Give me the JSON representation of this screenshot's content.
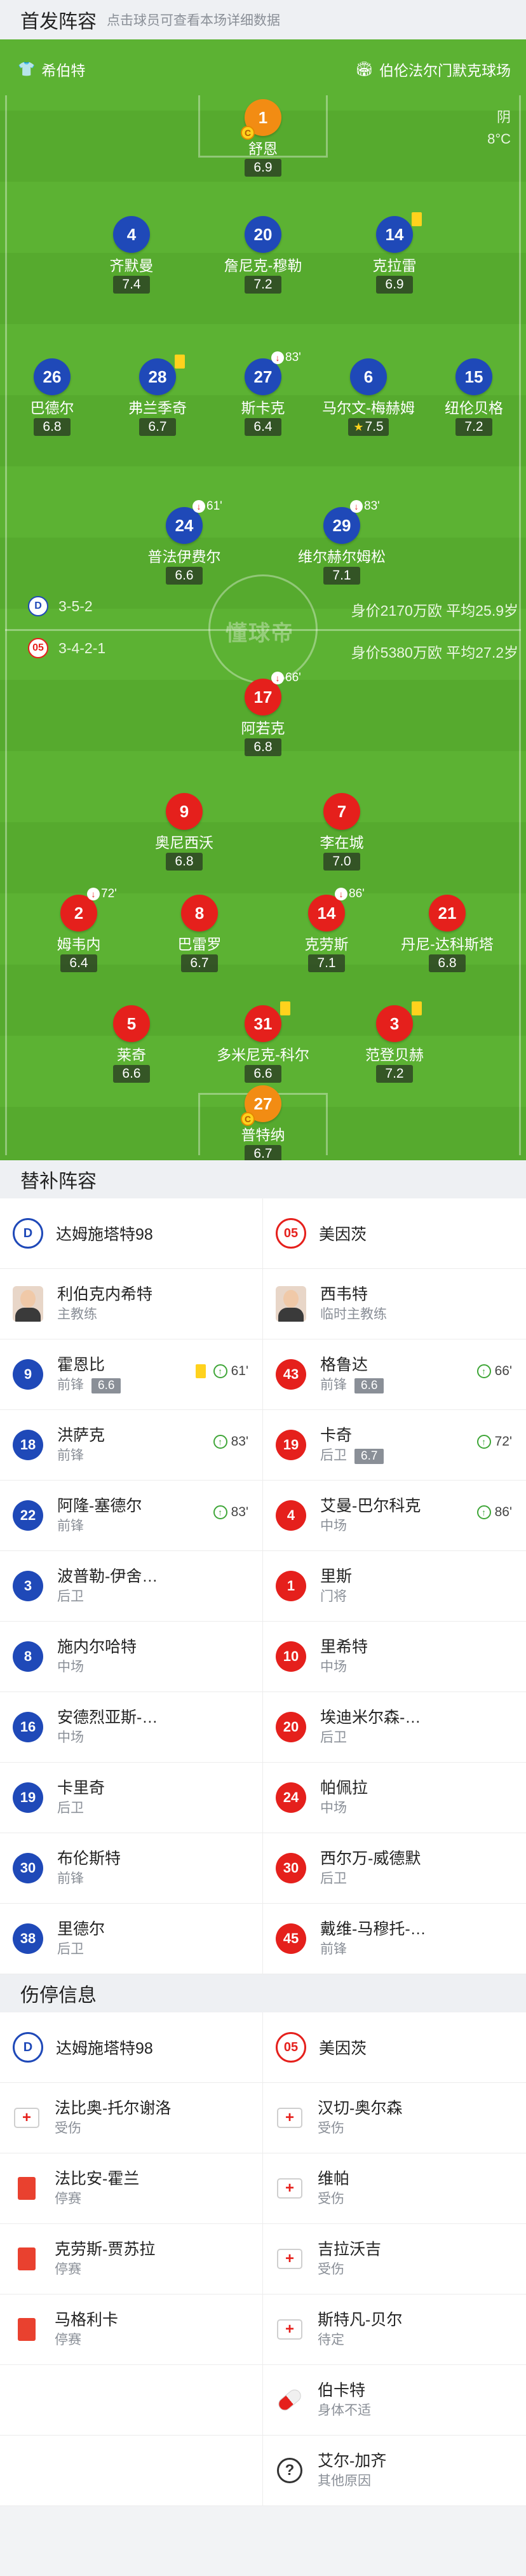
{
  "header": {
    "title": "首发阵容",
    "subtitle": "点击球员可查看本场详细数据"
  },
  "pitch": {
    "home_team": "希伯特",
    "away_venue": "伯伦法尔门默克球场",
    "weather": "阴",
    "temperature": "8°C",
    "watermark": "懂球帝",
    "home_formation": "3-5-2",
    "home_value": "身价2170万欧",
    "home_avg_age": "平均25.9岁",
    "away_formation": "3-4-2-1",
    "away_value": "身价5380万欧",
    "away_avg_age": "平均27.2岁"
  },
  "players": [
    {
      "num": "1",
      "name": "舒恩",
      "rating": "6.9",
      "side": "gk"
    },
    {
      "num": "4",
      "name": "齐默曼",
      "rating": "7.4",
      "side": "home"
    },
    {
      "num": "20",
      "name": "詹尼克-穆勒",
      "rating": "7.2",
      "side": "home"
    },
    {
      "num": "14",
      "name": "克拉雷",
      "rating": "6.9",
      "side": "home"
    },
    {
      "num": "26",
      "name": "巴德尔",
      "rating": "6.8",
      "side": "home"
    },
    {
      "num": "28",
      "name": "弗兰季奇",
      "rating": "6.7",
      "side": "home"
    },
    {
      "num": "27",
      "name": "斯卡克",
      "rating": "6.4",
      "side": "home",
      "sub": "83'"
    },
    {
      "num": "6",
      "name": "马尔文-梅赫姆",
      "rating": "7.5",
      "side": "home",
      "star": "★"
    },
    {
      "num": "15",
      "name": "纽伦贝格",
      "rating": "7.2",
      "side": "home"
    },
    {
      "num": "24",
      "name": "普法伊费尔",
      "rating": "6.6",
      "side": "home",
      "sub": "61'"
    },
    {
      "num": "29",
      "name": "维尔赫尔姆松",
      "rating": "7.1",
      "side": "home",
      "sub": "83'"
    },
    {
      "num": "17",
      "name": "阿若克",
      "rating": "6.8",
      "side": "away",
      "sub": "66'"
    },
    {
      "num": "9",
      "name": "奥尼西沃",
      "rating": "6.8",
      "side": "away"
    },
    {
      "num": "7",
      "name": "李在城",
      "rating": "7.0",
      "side": "away"
    },
    {
      "num": "2",
      "name": "姆韦内",
      "rating": "6.4",
      "side": "away",
      "sub": "72'"
    },
    {
      "num": "8",
      "name": "巴雷罗",
      "rating": "6.7",
      "side": "away"
    },
    {
      "num": "14",
      "name": "克劳斯",
      "rating": "7.1",
      "side": "away",
      "sub": "86'"
    },
    {
      "num": "21",
      "name": "丹尼-达科斯塔",
      "rating": "6.8",
      "side": "away"
    },
    {
      "num": "5",
      "name": "莱奇",
      "rating": "6.6",
      "side": "away"
    },
    {
      "num": "31",
      "name": "多米尼克-科尔",
      "rating": "6.6",
      "side": "away"
    },
    {
      "num": "3",
      "name": "范登贝赫",
      "rating": "7.2",
      "side": "away"
    },
    {
      "num": "27",
      "name": "普特纳",
      "rating": "6.7",
      "side": "gk"
    }
  ],
  "captain_mark": "C",
  "subs": {
    "title": "替补阵容",
    "home_team": "达姆施塔特98",
    "away_team": "美因茨",
    "home_coach": {
      "name": "利伯克内希特",
      "role": "主教练"
    },
    "away_coach": {
      "name": "西韦特",
      "role": "临时主教练"
    },
    "home": [
      {
        "num": "9",
        "name": "霍恩比",
        "pos": "前锋",
        "rating": "6.6",
        "event": "61'"
      },
      {
        "num": "18",
        "name": "洪萨克",
        "pos": "前锋",
        "event": "83'"
      },
      {
        "num": "22",
        "name": "阿隆-塞德尔",
        "pos": "前锋",
        "event": "83'"
      },
      {
        "num": "3",
        "name": "波普勒-伊舍…",
        "pos": "后卫"
      },
      {
        "num": "8",
        "name": "施内尔哈特",
        "pos": "中场"
      },
      {
        "num": "16",
        "name": "安德烈亚斯-…",
        "pos": "中场"
      },
      {
        "num": "19",
        "name": "卡里奇",
        "pos": "后卫"
      },
      {
        "num": "30",
        "name": "布伦斯特",
        "pos": "前锋"
      },
      {
        "num": "38",
        "name": "里德尔",
        "pos": "后卫"
      }
    ],
    "away": [
      {
        "num": "43",
        "name": "格鲁达",
        "pos": "前锋",
        "rating": "6.6",
        "event": "66'"
      },
      {
        "num": "19",
        "name": "卡奇",
        "pos": "后卫",
        "rating": "6.7",
        "event": "72'"
      },
      {
        "num": "4",
        "name": "艾曼-巴尔科克",
        "pos": "中场",
        "event": "86'"
      },
      {
        "num": "1",
        "name": "里斯",
        "pos": "门将"
      },
      {
        "num": "10",
        "name": "里希特",
        "pos": "中场"
      },
      {
        "num": "20",
        "name": "埃迪米尔森-…",
        "pos": "后卫"
      },
      {
        "num": "24",
        "name": "帕佩拉",
        "pos": "中场"
      },
      {
        "num": "30",
        "name": "西尔万-威德默",
        "pos": "后卫"
      },
      {
        "num": "45",
        "name": "戴维-马穆托-…",
        "pos": "前锋"
      }
    ]
  },
  "injuries": {
    "title": "伤停信息",
    "home_team": "达姆施塔特98",
    "away_team": "美因茨",
    "home": [
      {
        "name": "法比奥-托尔谢洛",
        "status": "受伤",
        "icon": "medkit-icon"
      },
      {
        "name": "法比安-霍兰",
        "status": "停赛",
        "icon": "red-card-icon"
      },
      {
        "name": "克劳斯-贾苏拉",
        "status": "停赛",
        "icon": "red-card-icon"
      },
      {
        "name": "马格利卡",
        "status": "停赛",
        "icon": "red-card-icon"
      }
    ],
    "away": [
      {
        "name": "汉切-奥尔森",
        "status": "受伤",
        "icon": "medkit-icon"
      },
      {
        "name": "维帕",
        "status": "受伤",
        "icon": "medkit-icon"
      },
      {
        "name": "吉拉沃吉",
        "status": "受伤",
        "icon": "medkit-icon"
      },
      {
        "name": "斯特凡-贝尔",
        "status": "待定",
        "icon": "medkit-icon"
      },
      {
        "name": "伯卡特",
        "status": "身体不适",
        "icon": "pill-icon"
      },
      {
        "name": "艾尔-加齐",
        "status": "其他原因",
        "icon": "question-icon"
      }
    ]
  }
}
